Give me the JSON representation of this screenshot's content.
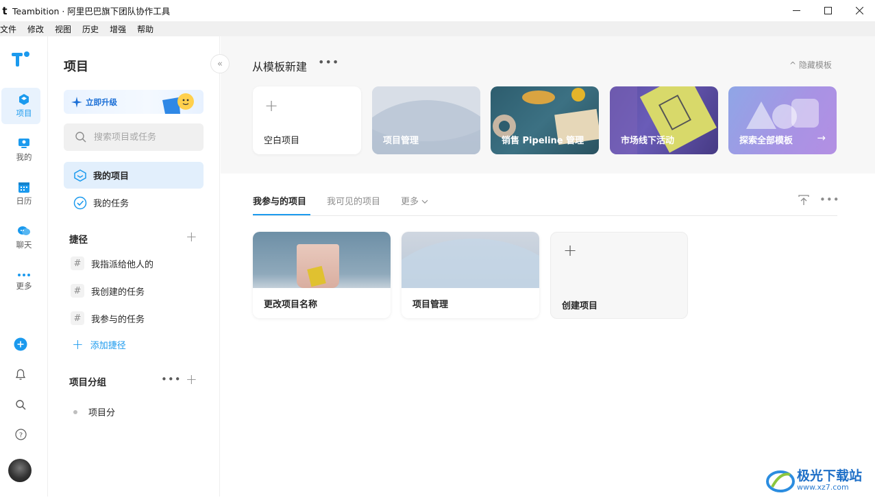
{
  "window": {
    "app_glyph": "t",
    "title": "Teambition · 阿里巴巴旗下团队协作工具",
    "controls": [
      "minimize-icon",
      "maximize-icon",
      "close-icon"
    ]
  },
  "menu": [
    "文件",
    "修改",
    "视图",
    "历史",
    "增强",
    "帮助"
  ],
  "rail": {
    "items": [
      {
        "label": "项目",
        "icon": "project-cube-icon",
        "active": true
      },
      {
        "label": "我的",
        "icon": "monitor-icon"
      },
      {
        "label": "日历",
        "icon": "calendar-icon"
      },
      {
        "label": "聊天",
        "icon": "chat-bubbles-icon"
      },
      {
        "label": "更多",
        "icon": "more-dots-icon"
      }
    ],
    "bottom": [
      "add-circle-icon",
      "bell-icon",
      "search-icon",
      "help-icon",
      "avatar"
    ],
    "accent": "#1b9aee"
  },
  "sidebar": {
    "title": "项目",
    "upgrade_label": "立即升级",
    "search_placeholder": "搜索项目或任务",
    "nav": [
      {
        "label": "我的项目",
        "active": true
      },
      {
        "label": "我的任务"
      }
    ],
    "shortcuts_title": "捷径",
    "shortcuts": [
      "我指派给他人的",
      "我创建的任务",
      "我参与的任务"
    ],
    "add_shortcut": "添加捷径",
    "groups_title": "项目分组",
    "groups": [
      "项目分"
    ]
  },
  "templates": {
    "title": "从模板新建",
    "hide_label": "隐藏模板",
    "hide_glyph": "^",
    "cards": [
      {
        "label": "空白项目"
      },
      {
        "label": "项目管理"
      },
      {
        "label": "销售 Pipeline 管理"
      },
      {
        "label": "市场线下活动"
      },
      {
        "label": "探索全部模板"
      }
    ]
  },
  "projects": {
    "tabs": [
      "我参与的项目",
      "我可见的项目",
      "更多"
    ],
    "active_tab": "我参与的项目",
    "cards": [
      {
        "name": "更改项目名称"
      },
      {
        "name": "项目管理"
      }
    ],
    "create_label": "创建项目"
  },
  "watermark": {
    "text": "极光下载站",
    "url": "www.xz7.com"
  }
}
